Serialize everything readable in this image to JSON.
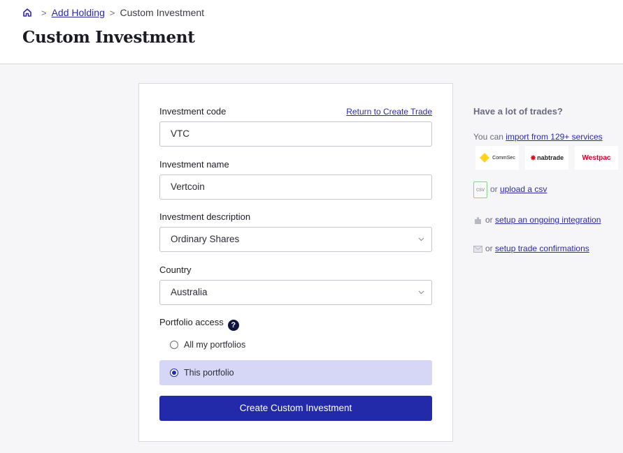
{
  "breadcrumb": {
    "home_icon": "home-icon",
    "items": [
      "Add Holding",
      "Custom Investment"
    ],
    "separator": ">"
  },
  "page": {
    "title": "Custom Investment"
  },
  "form": {
    "code_label": "Investment code",
    "return_link": "Return to Create Trade",
    "code_value": "VTC",
    "name_label": "Investment name",
    "name_value": "Vertcoin",
    "description_label": "Investment description",
    "description_value": "Ordinary Shares",
    "country_label": "Country",
    "country_value": "Australia",
    "access_label": "Portfolio access",
    "help_glyph": "?",
    "access_options": [
      {
        "label": "All my portfolios",
        "checked": false
      },
      {
        "label": "This portfolio",
        "checked": true
      }
    ],
    "submit_label": "Create Custom Investment"
  },
  "sidebar": {
    "title": "Have a lot of trades?",
    "import_prefix": "You can ",
    "import_link": "import from 129+ services",
    "logos": [
      "CommSec",
      "nabtrade",
      "Westpac"
    ],
    "csv_icon_text": "csv",
    "csv_prefix": "or ",
    "csv_link": "upload a csv",
    "integration_prefix": "or ",
    "integration_link": "setup an ongoing integration",
    "confirm_prefix": "or ",
    "confirm_link": "setup trade confirmations"
  },
  "colors": {
    "primary": "#222aaa",
    "selected_bg": "#d6d7f6",
    "link": "#2a2aa8"
  }
}
